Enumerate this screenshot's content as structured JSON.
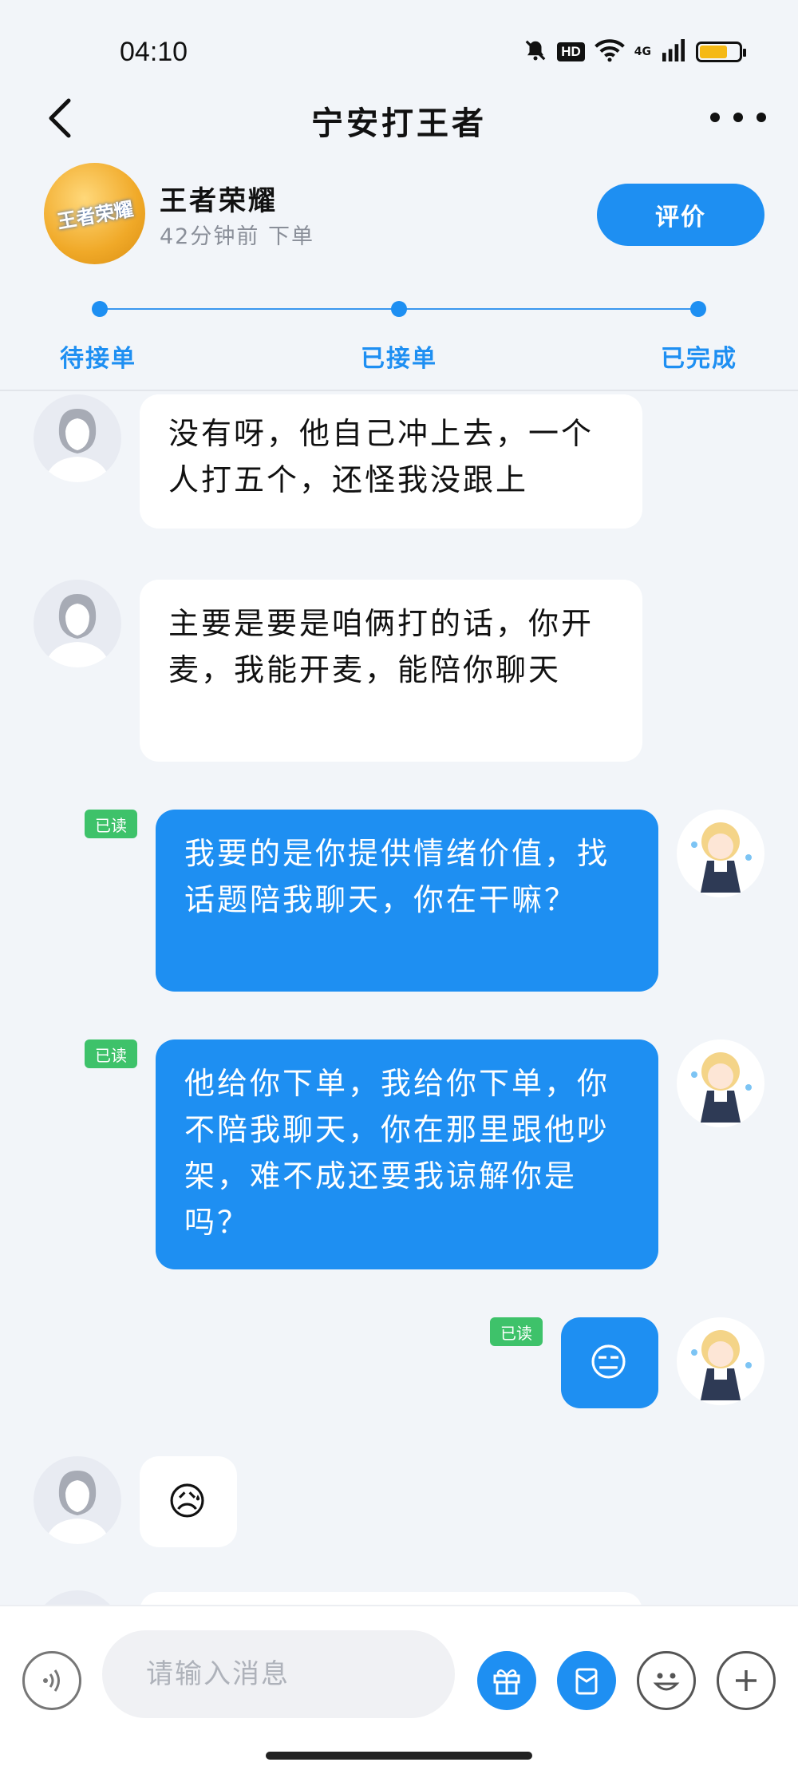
{
  "status_bar": {
    "time": "04:10",
    "hd": "HD",
    "network": "4G",
    "battery_percent": 70
  },
  "header": {
    "title": "宁安打王者"
  },
  "order": {
    "game_logo_text": "王者荣耀",
    "game_name": "王者荣耀",
    "time_ago": "42分钟前 下单",
    "rate_label": "评价",
    "steps": [
      "待接单",
      "已接单",
      "已完成"
    ]
  },
  "messages": [
    {
      "from": "other",
      "text": "没有呀，他自己冲上去，一个人打五个，还怪我没跟上"
    },
    {
      "from": "other",
      "text": "主要是要是咱俩打的话，你开麦，我能开麦，能陪你聊天"
    },
    {
      "from": "me",
      "read": "已读",
      "text": "我要的是你提供情绪价值，找话题陪我聊天，你在干嘛？"
    },
    {
      "from": "me",
      "read": "已读",
      "text": "他给你下单，我给你下单，你不陪我聊天，你在那里跟他吵架，难不成还要我谅解你是吗？"
    },
    {
      "from": "me",
      "read": "已读",
      "text": "😑"
    },
    {
      "from": "other",
      "text": "😥"
    }
  ],
  "input": {
    "placeholder": "请输入消息"
  },
  "colors": {
    "accent": "#1e8ff2",
    "read_badge": "#3ec26a",
    "background": "#f2f5f9"
  }
}
